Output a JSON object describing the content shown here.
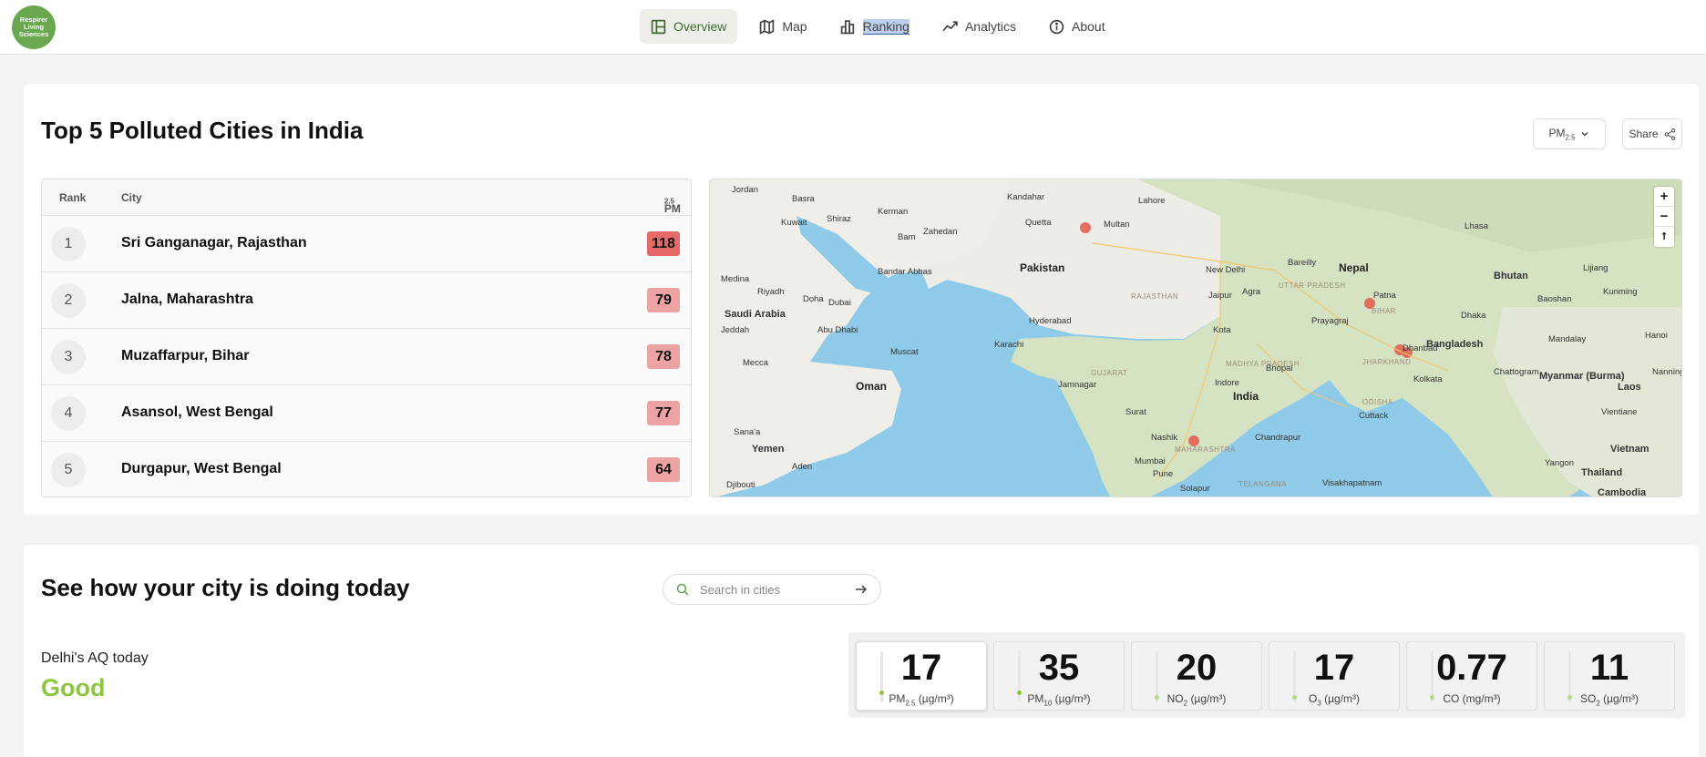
{
  "logo": {
    "line1": "Respirer",
    "line2": "Living",
    "line3": "Sciences"
  },
  "nav": [
    {
      "label": "Overview",
      "icon": "layout-icon"
    },
    {
      "label": "Map",
      "icon": "map-icon"
    },
    {
      "label": "Ranking",
      "icon": "bar-chart-icon"
    },
    {
      "label": "Analytics",
      "icon": "trend-line-icon"
    },
    {
      "label": "About",
      "icon": "info-icon"
    }
  ],
  "ranking": {
    "title": "Top 5 Polluted Cities in India",
    "pollutant_dropdown": {
      "base": "PM",
      "sub": "2.5"
    },
    "share_label": "Share",
    "headers": {
      "rank": "Rank",
      "city": "City",
      "metric_base": "PM",
      "metric_sub": "2.5"
    },
    "rows": [
      {
        "rank": "1",
        "city": "Sri Ganganagar, Rajasthan",
        "value": "118",
        "color": "#e46a6a"
      },
      {
        "rank": "2",
        "city": "Jalna, Maharashtra",
        "value": "79",
        "color": "#eda3a3"
      },
      {
        "rank": "3",
        "city": "Muzaffarpur, Bihar",
        "value": "78",
        "color": "#eda3a3"
      },
      {
        "rank": "4",
        "city": "Asansol, West Bengal",
        "value": "77",
        "color": "#eda3a3"
      },
      {
        "rank": "5",
        "city": "Durgapur, West Bengal",
        "value": "64",
        "color": "#eda3a3"
      }
    ]
  },
  "map": {
    "countries": [
      "Pakistan",
      "Nepal",
      "Bhutan",
      "Bangladesh",
      "India",
      "Oman",
      "Yemen",
      "Saudi Arabia",
      "Thailand",
      "Cambodia",
      "Vietnam",
      "Laos"
    ],
    "cities": [
      "Jordan",
      "Basra",
      "Kuwait",
      "Shiraz",
      "Kerman",
      "Kandahar",
      "Lahore",
      "Multan",
      "Quetta",
      "New Delhi",
      "Bareilly",
      "Lhasa",
      "Jaipur",
      "Agra",
      "Hyderabad",
      "Karachi",
      "Kota",
      "Prayagraj",
      "Patna",
      "Dhanbad",
      "Dhaka",
      "Kolkata",
      "Chattogram",
      "Indore",
      "Bhopal",
      "Jamnagar",
      "Surat",
      "Nashik",
      "Mumbai",
      "Pune",
      "Solapur",
      "Chandrapur",
      "Cuttack",
      "Visakhapatnam",
      "Myanmar (Burma)",
      "Riyadh",
      "Doha",
      "Dubai",
      "Muscat",
      "Abu Dhabi",
      "Bandar Abbas",
      "Zahedan",
      "Bam",
      "Medina",
      "Jeddah",
      "Mecca",
      "Aden",
      "Djibouti",
      "Sana'a",
      "Mandalay",
      "Kunming",
      "Lijiang",
      "Hanoi",
      "Yangon",
      "Vientiane",
      "Baoshan",
      "Nanning"
    ],
    "states": [
      "RAJASTHAN",
      "UTTAR PRADESH",
      "BIHAR",
      "MADHYA PRADESH",
      "GUJARAT",
      "MAHARASHTRA",
      "TELANGANA",
      "JHARKHAND",
      "ODISHA"
    ],
    "zoom_in": "+",
    "zoom_out": "−",
    "reset": "⭡",
    "attribution": "Cambodia"
  },
  "city_check": {
    "title": "See how your city is doing today",
    "search_placeholder": "Search in cities",
    "aq_label": "Delhi's AQ today",
    "aq_status": "Good",
    "pollutants": [
      {
        "value": "17",
        "base": "PM",
        "sub": "2.5",
        "unit": "(µg/m³)",
        "level": 0.1
      },
      {
        "value": "35",
        "base": "PM",
        "sub": "10",
        "unit": "(µg/m³)",
        "level": 0.1
      },
      {
        "value": "20",
        "base": "NO",
        "sub": "2",
        "unit": "(µg/m³)",
        "level": 0.02
      },
      {
        "value": "17",
        "base": "O",
        "sub": "3",
        "unit": "(µg/m³)",
        "level": 0.02
      },
      {
        "value": "0.77",
        "base": "CO",
        "sub": "",
        "unit": "(mg/m³)",
        "level": 0.02
      },
      {
        "value": "11",
        "base": "SO",
        "sub": "2",
        "unit": "(µg/m³)",
        "level": 0.02
      }
    ]
  }
}
